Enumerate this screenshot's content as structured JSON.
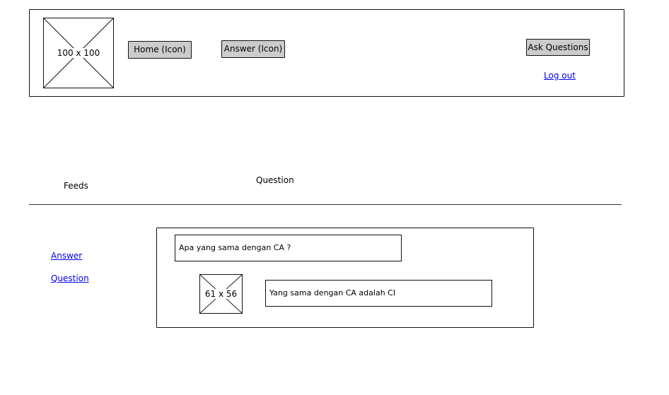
{
  "header": {
    "logo_label": "100 x 100",
    "home_button": "Home (Icon)",
    "answer_button": "Answer (Icon)",
    "ask_button": "Ask Questions",
    "logout_link": "Log out"
  },
  "sections": {
    "feeds_title": "Feeds",
    "question_title": "Question"
  },
  "sidebar": {
    "items": [
      {
        "label": "Answer"
      },
      {
        "label": "Question"
      }
    ]
  },
  "feed": {
    "question_text": "Apa yang sama dengan CA ?",
    "avatar_label": "61 x 56",
    "answer_text": "Yang sama dengan CA adalah CI"
  },
  "colors": {
    "button_fill": "#cccccc",
    "link": "#0000ee",
    "stroke": "#111111"
  }
}
